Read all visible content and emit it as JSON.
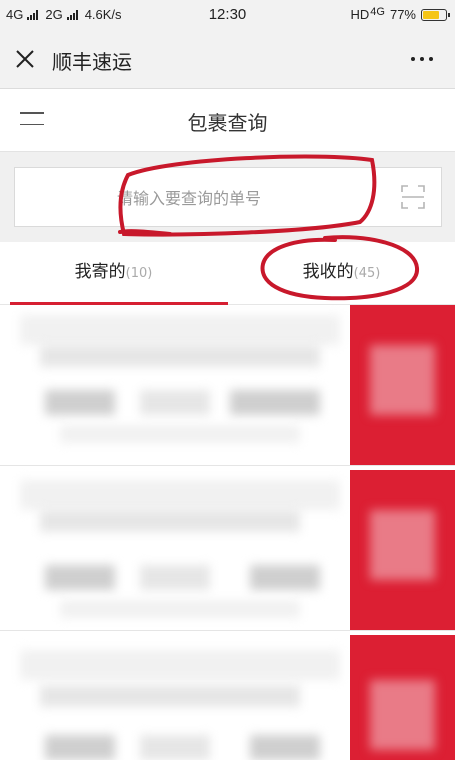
{
  "status_bar": {
    "network1": "4G",
    "network2": "2G",
    "speed": "4.6K/s",
    "time": "12:30",
    "hd": "HD",
    "network3": "4G",
    "battery_percent": "77%",
    "battery_level": 0.77
  },
  "titlebar": {
    "title": "顺丰速运"
  },
  "page_header": {
    "title": "包裹查询"
  },
  "search": {
    "placeholder": "请输入要查询的单号",
    "value": ""
  },
  "tabs": [
    {
      "label": "我寄的",
      "count": "(10)",
      "active": true
    },
    {
      "label": "我收的",
      "count": "(45)",
      "active": false
    }
  ],
  "colors": {
    "accent": "#d61f32",
    "annotation": "#c8182b"
  },
  "icons": {
    "close": "close-icon",
    "more": "more-icon",
    "menu": "menu-icon",
    "scan": "scan-icon",
    "battery": "battery-icon"
  }
}
